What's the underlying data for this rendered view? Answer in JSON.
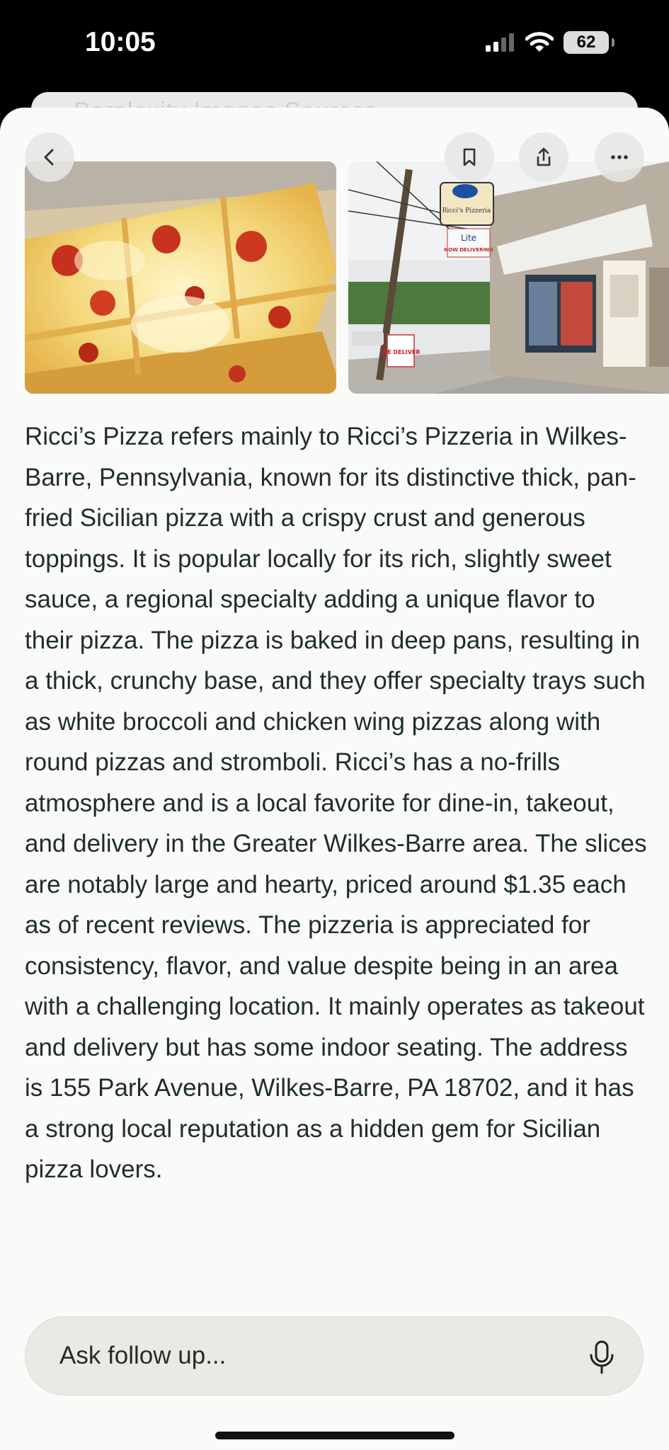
{
  "status": {
    "time": "10:05",
    "battery": "62"
  },
  "under_sheet": {
    "text": "Perplexity   Images   Sources"
  },
  "toolbar": {
    "back": "back-icon",
    "bookmark": "bookmark-icon",
    "share": "share-icon",
    "more": "more-icon"
  },
  "images": [
    {
      "alt": "Sicilian pizza slices in a box"
    },
    {
      "alt": "Ricci's Pizzeria storefront",
      "sign_text": "Ricci's Pizzeria",
      "sign2_text": "Lite",
      "sign3_text": "NOW DELIVERING",
      "sign4_text": "WE DELIVER"
    }
  ],
  "answer": {
    "text": "Ricci’s Pizza refers mainly to Ricci’s Pizzeria in Wilkes-Barre, Pennsylvania, known for its distinctive thick, pan-fried Sicilian pizza with a crispy crust and generous toppings. It is popular locally for its rich, slightly sweet sauce, a regional specialty adding a unique flavor to their pizza. The pizza is baked in deep pans, resulting in a thick, crunchy base, and they offer specialty trays such as white broccoli and chicken wing pizzas along with round pizzas and stromboli. Ricci’s has a no-frills atmosphere and is a local favorite for dine-in, takeout, and delivery in the Greater Wilkes-Barre area. The slices are notably large and hearty, priced around $1.35 each as of recent reviews. The pizzeria is appreciated for consistency, flavor, and value despite being in an area with a challenging location. It mainly operates as takeout and delivery but has some indoor seating. The address is 155 Park Avenue, Wilkes-Barre, PA 18702, and it has a strong local reputation as a hidden gem for Sicilian pizza lovers."
  },
  "ask": {
    "placeholder": "Ask follow up...",
    "mic": "microphone-icon"
  }
}
